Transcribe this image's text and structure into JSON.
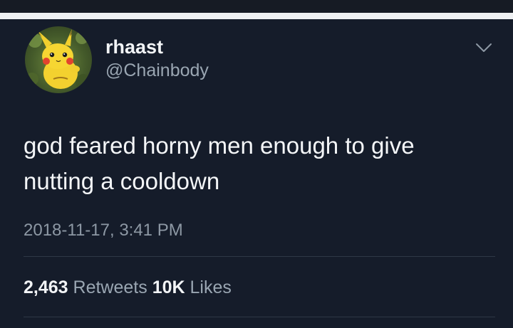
{
  "tweet": {
    "display_name": "rhaast",
    "handle": "@Chainbody",
    "text_lines": [
      "god feared horny men enough to give",
      "nutting a cooldown"
    ],
    "timestamp": "2018-11-17, 3:41 PM",
    "stats": {
      "retweets_count": "2,463",
      "retweets_label": "Retweets",
      "likes_count": "10K",
      "likes_label": "Likes"
    }
  },
  "icons": {
    "avatar": "pikachu-avatar",
    "menu": "chevron-down-icon"
  },
  "colors": {
    "background": "#151c2a",
    "divider_band": "#eef0f2",
    "primary_text": "#f2f4f6",
    "secondary_text": "#9aa6b2",
    "rule": "#2e3846"
  }
}
